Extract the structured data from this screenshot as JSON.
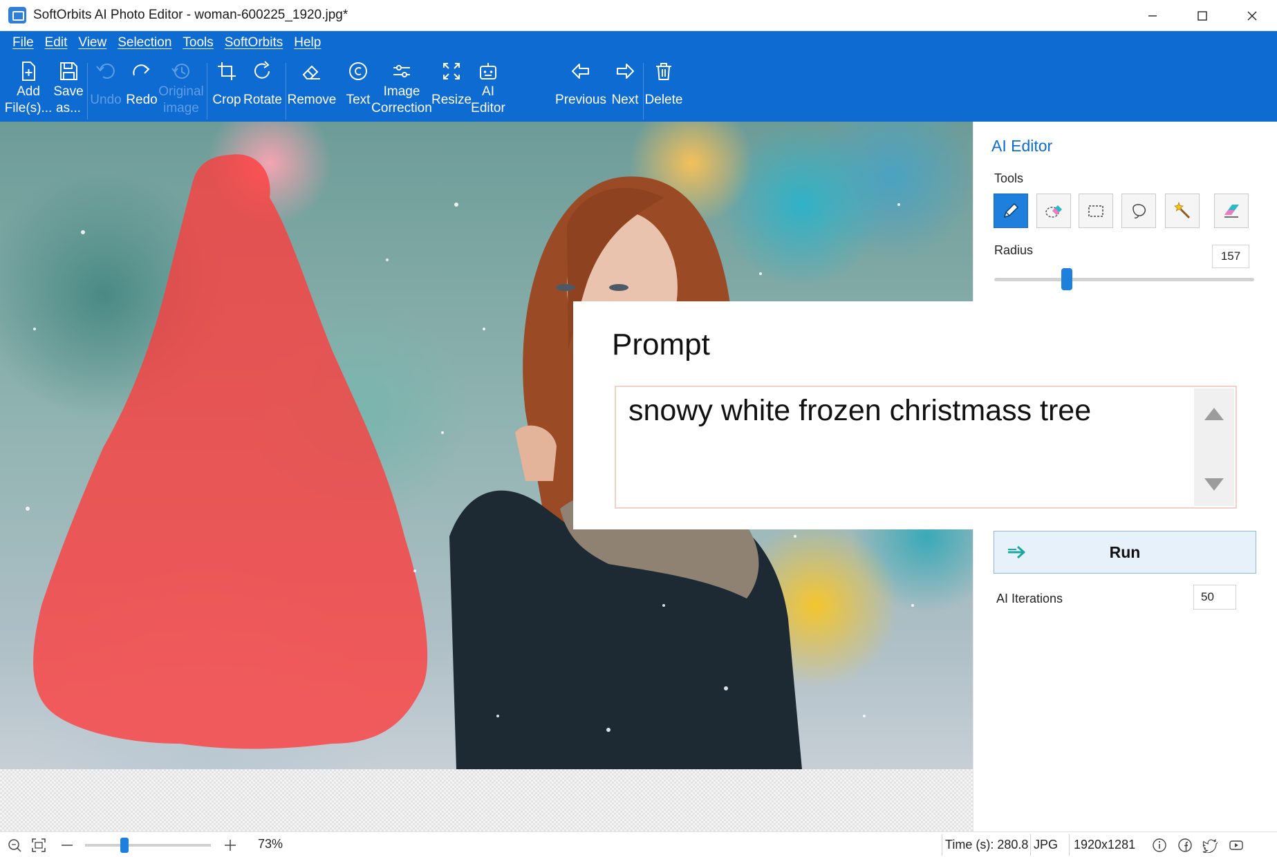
{
  "window": {
    "title": "SoftOrbits AI Photo Editor - woman-600225_1920.jpg*"
  },
  "menu": [
    "File",
    "Edit",
    "View",
    "Selection",
    "Tools",
    "SoftOrbits",
    "Help"
  ],
  "toolbar": {
    "add": [
      "Add",
      "File(s)..."
    ],
    "save": [
      "Save",
      "as..."
    ],
    "undo": "Undo",
    "redo": "Redo",
    "original": [
      "Original",
      "image"
    ],
    "crop": "Crop",
    "rotate": "Rotate",
    "remove": "Remove",
    "text": "Text",
    "image_correction": [
      "Image",
      "Correction"
    ],
    "resize": "Resize",
    "ai_editor": [
      "AI",
      "Editor"
    ],
    "previous": "Previous",
    "next": "Next",
    "delete": "Delete"
  },
  "panel": {
    "title": "AI Editor",
    "tools_label": "Tools",
    "tools": [
      "pencil-icon",
      "lasso-eraser-icon",
      "rect-select-icon",
      "lasso-icon",
      "magic-wand-icon",
      "eraser-icon"
    ],
    "radius_label": "Radius",
    "radius_value": "157",
    "radius_fraction": 0.27,
    "run_label": "Run",
    "iterations_label": "AI Iterations",
    "iterations_value": "50"
  },
  "prompt": {
    "title": "Prompt",
    "text": "snowy white frozen christmass tree"
  },
  "status": {
    "zoom": "73%",
    "zoom_fraction": 0.3,
    "time": "Time (s): 280.8",
    "format": "JPG",
    "dimensions": "1920x1281"
  },
  "colors": {
    "accent": "#0d6bd2",
    "mask": "#ff3b3b"
  }
}
